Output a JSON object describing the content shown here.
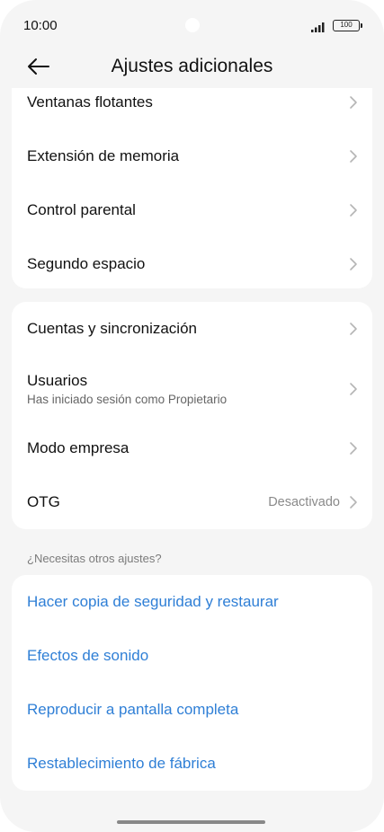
{
  "status_bar": {
    "time": "10:00",
    "battery": "100",
    "signal_icon": "signal-icon",
    "battery_icon": "battery-icon"
  },
  "header": {
    "back_icon": "back-arrow-icon",
    "title": "Ajustes adicionales"
  },
  "card_1": {
    "items": [
      {
        "label": "Ventanas flotantes"
      },
      {
        "label": "Extensión de memoria"
      },
      {
        "label": "Control parental"
      },
      {
        "label": "Segundo espacio"
      }
    ]
  },
  "card_2": {
    "items": [
      {
        "label": "Cuentas y sincronización"
      },
      {
        "label": "Usuarios",
        "subtitle": "Has iniciado sesión como Propietario"
      },
      {
        "label": "Modo empresa"
      },
      {
        "label": "OTG",
        "value": "Desactivado"
      }
    ]
  },
  "section_other": {
    "title": "¿Necesitas otros ajustes?",
    "items": [
      {
        "label": "Hacer copia de seguridad y restaurar"
      },
      {
        "label": "Efectos de sonido"
      },
      {
        "label": "Reproducir a pantalla completa"
      },
      {
        "label": "Restablecimiento de fábrica"
      }
    ]
  },
  "colors": {
    "background": "#f5f5f5",
    "card": "#ffffff",
    "link": "#2f7fd6",
    "secondary_text": "#8a8a8a"
  }
}
